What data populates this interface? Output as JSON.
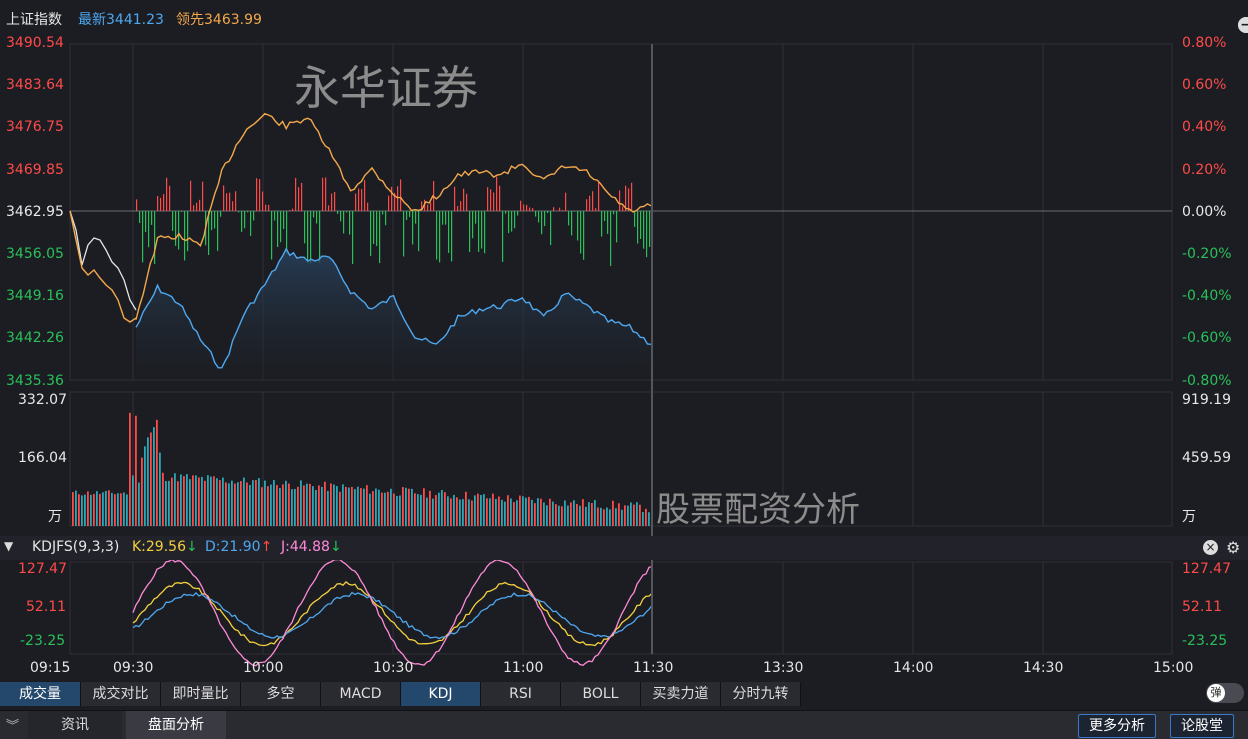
{
  "header": {
    "index_name": "上证指数",
    "latest_label": "最新3441.23",
    "lead_label": "领先3463.99",
    "icons": [
      "undo-icon",
      "zoom-in-icon",
      "zoom-out-icon"
    ]
  },
  "price_axis_left": [
    {
      "text": "3490.54",
      "color": "red"
    },
    {
      "text": "3483.64",
      "color": "red"
    },
    {
      "text": "3476.75",
      "color": "red"
    },
    {
      "text": "3469.85",
      "color": "red"
    },
    {
      "text": "3462.95",
      "color": "white"
    },
    {
      "text": "3456.05",
      "color": "green"
    },
    {
      "text": "3449.16",
      "color": "green"
    },
    {
      "text": "3442.26",
      "color": "green"
    },
    {
      "text": "3435.36",
      "color": "green"
    }
  ],
  "price_axis_right": [
    {
      "text": "0.80%",
      "color": "red"
    },
    {
      "text": "0.60%",
      "color": "red"
    },
    {
      "text": "0.40%",
      "color": "red"
    },
    {
      "text": "0.20%",
      "color": "red"
    },
    {
      "text": "0.00%",
      "color": "white"
    },
    {
      "text": "-0.20%",
      "color": "green"
    },
    {
      "text": "-0.40%",
      "color": "green"
    },
    {
      "text": "-0.60%",
      "color": "green"
    },
    {
      "text": "-0.80%",
      "color": "green"
    }
  ],
  "volume_axis_left": [
    "332.07",
    "166.04",
    "万"
  ],
  "volume_axis_right": [
    "919.19",
    "459.59",
    "万"
  ],
  "kdj": {
    "name": "KDJFS(9,3,3)",
    "k": "K:29.56",
    "d": "D:21.90",
    "j": "J:44.88",
    "axis_left": [
      "127.47",
      "52.11",
      "-23.25"
    ],
    "axis_right": [
      "127.47",
      "52.11",
      "-23.25"
    ]
  },
  "time_axis": [
    "09:15",
    "09:30",
    "10:00",
    "10:30",
    "11:00",
    "11:30",
    "13:30",
    "14:00",
    "14:30",
    "15:00"
  ],
  "watermarks": {
    "top": "永华证券",
    "bottom": "股票配资分析"
  },
  "indicator_tabs": [
    "成交量",
    "成交对比",
    "即时量比",
    "多空",
    "MACD",
    "KDJ",
    "RSI",
    "BOLL",
    "买卖力道",
    "分时九转"
  ],
  "active_tabs": [
    "成交量",
    "KDJ"
  ],
  "toggle_label": "弹",
  "bottom_tabs": [
    "资讯",
    "盘面分析"
  ],
  "bottom_buttons": [
    "更多分析",
    "论股堂"
  ],
  "colors": {
    "up": "#ff4a4a",
    "down": "#29c05a",
    "price_line": "#4ea8f0",
    "avg_line": "#f3a84c",
    "k": "#f4d03f",
    "d": "#4ea8f0",
    "j": "#ff8ad8",
    "active_tab": "#24486b"
  },
  "chart_data": {
    "type": "line",
    "x": [
      "09:30",
      "09:35",
      "09:40",
      "09:45",
      "09:50",
      "09:55",
      "10:00",
      "10:05",
      "10:10",
      "10:15",
      "10:20",
      "10:25",
      "10:30",
      "10:35",
      "10:40",
      "10:45",
      "10:50",
      "10:55",
      "11:00",
      "11:05",
      "11:10",
      "11:15",
      "11:20",
      "11:25",
      "11:30"
    ],
    "series": [
      {
        "name": "最新",
        "values": [
          3444.0,
          3450.5,
          3448.0,
          3442.0,
          3437.0,
          3446.0,
          3451.0,
          3456.5,
          3455.0,
          3455.5,
          3450.0,
          3447.0,
          3449.0,
          3442.5,
          3441.0,
          3445.5,
          3447.0,
          3447.5,
          3449.0,
          3445.5,
          3449.5,
          3447.5,
          3445.0,
          3444.0,
          3441.23
        ]
      },
      {
        "name": "领先",
        "values": [
          3445.5,
          3458.5,
          3459.0,
          3457.5,
          3469.5,
          3476.0,
          3479.0,
          3477.0,
          3478.5,
          3473.0,
          3466.5,
          3470.0,
          3466.0,
          3463.0,
          3465.5,
          3469.0,
          3469.5,
          3469.0,
          3471.0,
          3468.0,
          3470.5,
          3469.5,
          3466.0,
          3463.0,
          3463.99
        ]
      }
    ],
    "ylim": [
      3435.36,
      3490.54
    ]
  }
}
